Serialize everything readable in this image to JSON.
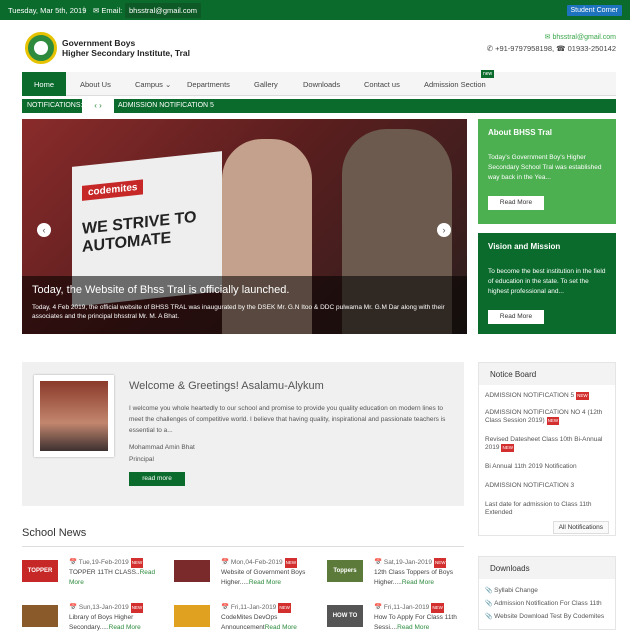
{
  "topbar": {
    "date": "Tuesday, Mar 5th, 2019",
    "sep": "|",
    "email_label": "✉ Email:",
    "email": "bhsstral@gmail.com",
    "corner": "Student Corner"
  },
  "header": {
    "school_line1": "Government Boys",
    "school_line2": "Higher Secondary Institute, Tral",
    "mail": "✉ bhsstral@gmail.com",
    "phone": "✆ +91-9797958198, ☎ 01933-250142"
  },
  "nav": {
    "items": [
      "Home",
      "About Us",
      "Campus ⌄",
      "Departments",
      "Gallery",
      "Downloads",
      "Contact us",
      "Admission Section"
    ],
    "new_badge": "new"
  },
  "notifications": {
    "label": "NOTIFICATIONS:",
    "arrows": "‹ ›",
    "marquee": "ADMISSION NOTIFICATION 5"
  },
  "slider": {
    "title": "Today, the Website of Bhss Tral is officially launched.",
    "text": "Today, 4 Feb 2019, the official website of BHSS TRAL was inaugurated by the DSEK Mr. G.N Itoo & DDC pulwama Mr. G.M Dar along with their associates and the principal bhsstral Mr. M. A Bhat.",
    "banner_brand": "codemites",
    "banner_text": "WE STRIVE TO AUTOMATE",
    "prev": "‹",
    "next": "›"
  },
  "about": {
    "title": "About BHSS Tral",
    "text": "Today's Government Boy's Higher Secondary School Tral was established way back in the Yea...",
    "button": "Read More",
    "color": "#4caf50"
  },
  "vision": {
    "title": "Vision and Mission",
    "text": "To become the best institution in the field of education in the state. To set the highest professional and...",
    "button": "Read More",
    "color": "#0a6b2c"
  },
  "welcome": {
    "title": "Welcome & Greetings! Asalamu-Alykum",
    "text": "I welcome you whole heartedly to our school and promise to provide you quality education on modern lines to meet the challenges of competitive world. I believe that having quality, inspirational and passionate teachers is essential to a...",
    "name": "Mohammad Amin Bhat",
    "role": "Principal",
    "button": "read more"
  },
  "notice_board": {
    "title": "Notice Board",
    "items": [
      {
        "text": "ADMISSION NOTIFICATION 5",
        "new": true
      },
      {
        "text": "ADMISSION NOTIFICATION NO 4 (12th Class Session 2019)",
        "new": true
      },
      {
        "text": "Revised Datesheet Class 10th Bi-Annual 2019",
        "new": true
      },
      {
        "text": "Bi Annual 11th 2019 Notification",
        "new": false
      },
      {
        "text": "ADMISSION NOTIFICATION 3",
        "new": false
      },
      {
        "text": "Last date for admission to Class 11th Extended",
        "new": false
      }
    ],
    "new_label": "NEW",
    "all_button": "All Notifications"
  },
  "school_news": {
    "title": "School News",
    "items": [
      {
        "date": "📅 Tue,19-Feb-2019",
        "title": "TOPPER 11TH CLASS..",
        "more": "Read More",
        "thumb": "TOPPER",
        "thumb_color": "#c62828"
      },
      {
        "date": "📅 Mon,04-Feb-2019",
        "title": "Website of Government Boys Higher.....",
        "more": "Read More",
        "thumb": "",
        "thumb_color": "#7a2a2a"
      },
      {
        "date": "📅 Sat,19-Jan-2019",
        "title": "12th Class Toppers of Boys Higher.....",
        "more": "Read More",
        "thumb": "Toppers",
        "thumb_color": "#5c7a3a"
      },
      {
        "date": "📅 Sun,13-Jan-2019",
        "title": "Library of Boys Higher Secondary.....",
        "more": "Read More",
        "thumb": "",
        "thumb_color": "#8b5a2b"
      },
      {
        "date": "📅 Fri,11-Jan-2019",
        "title": "CodeMites DevOps Announcement",
        "more": "Read More",
        "thumb": "",
        "thumb_color": "#e0a020"
      },
      {
        "date": "📅 Fri,11-Jan-2019",
        "title": "How To Apply For Class 11th Sessi....",
        "more": "Read More",
        "thumb": "HOW TO APPLY",
        "thumb_color": "#555"
      }
    ],
    "new_label": "NEW"
  },
  "downloads": {
    "title": "Downloads",
    "items": [
      "Syllabi Change",
      "Admission Notification For Class 11th",
      "Website Download Test By Codemites"
    ]
  }
}
